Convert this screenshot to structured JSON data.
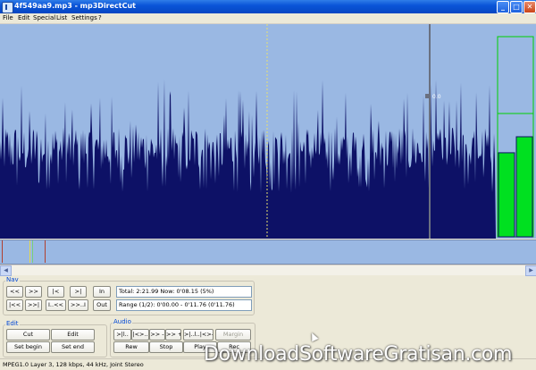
{
  "window": {
    "title": "4f549aa9.mp3 - mp3DirectCut",
    "minimize": "_",
    "maximize": "□",
    "close": "✕"
  },
  "menu": [
    "File",
    "Edit",
    "Special",
    "List",
    "Settings",
    "?"
  ],
  "waveform": {
    "marker_label": "0.0",
    "level_meter": [
      0.42,
      0.5
    ]
  },
  "nav": {
    "label": "Nav",
    "row1": [
      "<<",
      ">>",
      "|<",
      ">|",
      "In"
    ],
    "row2": [
      "|<<",
      ">>|",
      "I..<<",
      ">>..I",
      "Out"
    ],
    "total_now": "Total: 2:21.99   Now: 0'08.15   (5%)",
    "range": "Range (1/2): 0'00.00 - 0'11.76 (0'11.76)"
  },
  "edit": {
    "label": "Edit",
    "cut": "Cut",
    "edit": "Edit",
    "set_begin": "Set begin",
    "set_end": "Set end"
  },
  "audio": {
    "label": "Audio",
    "row1": [
      ">|l..",
      "|<>..",
      ">> -",
      ">> +",
      ">|..l..|<>-",
      "Margin"
    ],
    "row2": [
      "Rew",
      "Stop",
      "Play",
      "Rec"
    ]
  },
  "status": "MPEG1.0 Layer 3, 128 kbps, 44 kHz, Joint Stereo",
  "watermark": "DownloadSoftwareGratisan.com",
  "colors": {
    "wave_bg": "#9ab8e3",
    "wave_fg": "#0d1166",
    "meter": "#00e020"
  }
}
